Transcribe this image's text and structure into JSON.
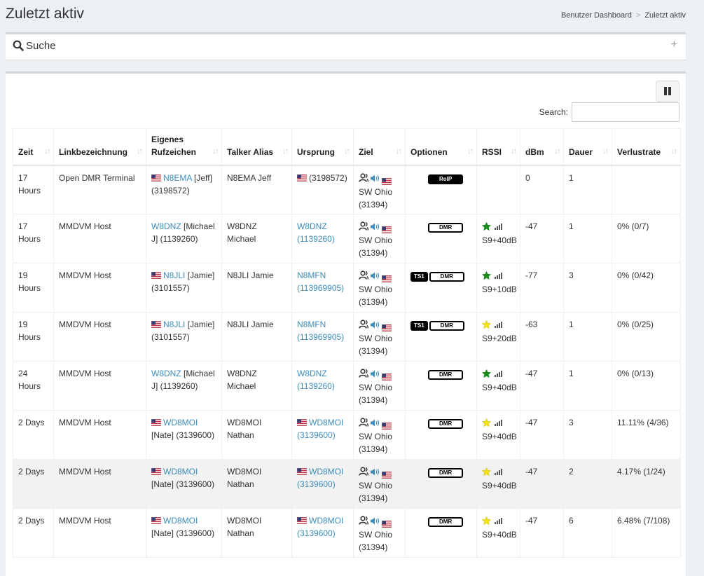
{
  "header": {
    "title": "Zuletzt aktiv",
    "breadcrumb": [
      "Benutzer Dashboard",
      "Zuletzt aktiv"
    ]
  },
  "search_panel": {
    "title": "Suche",
    "expand_icon": "plus-icon"
  },
  "table": {
    "search_label": "Search:",
    "search_value": "",
    "columns": [
      "Zeit",
      "Linkbezeichnung",
      "Eigenes Rufzeichen",
      "Talker Alias",
      "Ursprung",
      "Ziel",
      "Optionen",
      "RSSI",
      "dBm",
      "Dauer",
      "Verlustrate"
    ],
    "rows": [
      {
        "zeit": "17 Hours",
        "link": "Open DMR Terminal",
        "call": "N8EMA",
        "call_flag": true,
        "call_rest": "[Jeff] (3198572)",
        "alias": "N8EMA Jeff",
        "orig_flag": true,
        "orig_link": "",
        "orig_rest": "(3198572)",
        "ziel": "SW Ohio (31394)",
        "ts": "",
        "opt": "RoIP",
        "star": "",
        "rssi": "",
        "dbm": "0",
        "dauer": "1",
        "verlust": ""
      },
      {
        "zeit": "17 Hours",
        "link": "MMDVM Host",
        "call": "W8DNZ",
        "call_flag": false,
        "call_rest": "[Michael J] (1139260)",
        "alias": "W8DNZ Michael",
        "orig_flag": false,
        "orig_link": "W8DNZ (1139260)",
        "orig_rest": "",
        "ziel": "SW Ohio (31394)",
        "ts": "",
        "opt": "DMR",
        "star": "green",
        "rssi": "S9+40dB",
        "dbm": "-47",
        "dauer": "1",
        "verlust": "0% (0/7)"
      },
      {
        "zeit": "19 Hours",
        "link": "MMDVM Host",
        "call": "N8JLI",
        "call_flag": true,
        "call_rest": "[Jamie] (3101557)",
        "alias": "N8JLI Jamie",
        "orig_flag": false,
        "orig_link": "N8MFN (113969905)",
        "orig_rest": "",
        "ziel": "SW Ohio (31394)",
        "ts": "TS1",
        "opt": "DMR",
        "star": "green",
        "rssi": "S9+10dB",
        "dbm": "-77",
        "dauer": "3",
        "verlust": "0% (0/42)"
      },
      {
        "zeit": "19 Hours",
        "link": "MMDVM Host",
        "call": "N8JLI",
        "call_flag": true,
        "call_rest": "[Jamie] (3101557)",
        "alias": "N8JLI Jamie",
        "orig_flag": false,
        "orig_link": "N8MFN (113969905)",
        "orig_rest": "",
        "ziel": "SW Ohio (31394)",
        "ts": "TS1",
        "opt": "DMR",
        "star": "yellow",
        "rssi": "S9+20dB",
        "dbm": "-63",
        "dauer": "1",
        "verlust": "0% (0/25)"
      },
      {
        "zeit": "24 Hours",
        "link": "MMDVM Host",
        "call": "W8DNZ",
        "call_flag": false,
        "call_rest": "[Michael J] (1139260)",
        "alias": "W8DNZ Michael",
        "orig_flag": false,
        "orig_link": "W8DNZ (1139260)",
        "orig_rest": "",
        "ziel": "SW Ohio (31394)",
        "ts": "",
        "opt": "DMR",
        "star": "green",
        "rssi": "S9+40dB",
        "dbm": "-47",
        "dauer": "1",
        "verlust": "0% (0/13)"
      },
      {
        "zeit": "2 Days",
        "link": "MMDVM Host",
        "call": "WD8MOI",
        "call_flag": true,
        "call_rest": "[Nate] (3139600)",
        "alias": "WD8MOI Nathan",
        "orig_flag": true,
        "orig_link": "WD8MOI (3139600)",
        "orig_rest": "",
        "ziel": "SW Ohio (31394)",
        "ts": "",
        "opt": "DMR",
        "star": "yellow",
        "rssi": "S9+40dB",
        "dbm": "-47",
        "dauer": "3",
        "verlust": "11.11% (4/36)"
      },
      {
        "zeit": "2 Days",
        "link": "MMDVM Host",
        "call": "WD8MOI",
        "call_flag": true,
        "call_rest": "[Nate] (3139600)",
        "alias": "WD8MOI Nathan",
        "orig_flag": true,
        "orig_link": "WD8MOI (3139600)",
        "orig_rest": "",
        "ziel": "SW Ohio (31394)",
        "ts": "",
        "opt": "DMR",
        "star": "yellow",
        "rssi": "S9+40dB",
        "dbm": "-47",
        "dauer": "2",
        "verlust": "4.17% (1/24)"
      },
      {
        "zeit": "2 Days",
        "link": "MMDVM Host",
        "call": "WD8MOI",
        "call_flag": true,
        "call_rest": "[Nate] (3139600)",
        "alias": "WD8MOI Nathan",
        "orig_flag": true,
        "orig_link": "WD8MOI (3139600)",
        "orig_rest": "",
        "ziel": "SW Ohio (31394)",
        "ts": "",
        "opt": "DMR",
        "star": "yellow",
        "rssi": "S9+40dB",
        "dbm": "-47",
        "dauer": "6",
        "verlust": "6.48% (7/108)"
      }
    ],
    "shaded_row": 6
  },
  "colors": {
    "link": "#3c8dbc",
    "star_green": "#1a8a1a",
    "star_yellow": "#f2e21a",
    "page_bg": "#ecf0f5"
  },
  "icons": [
    "search-icon",
    "plus-icon",
    "pause-icon",
    "sort-icon",
    "us-flag-icon",
    "user-group-icon",
    "speaker-icon",
    "star-icon",
    "signal-bars-icon"
  ]
}
